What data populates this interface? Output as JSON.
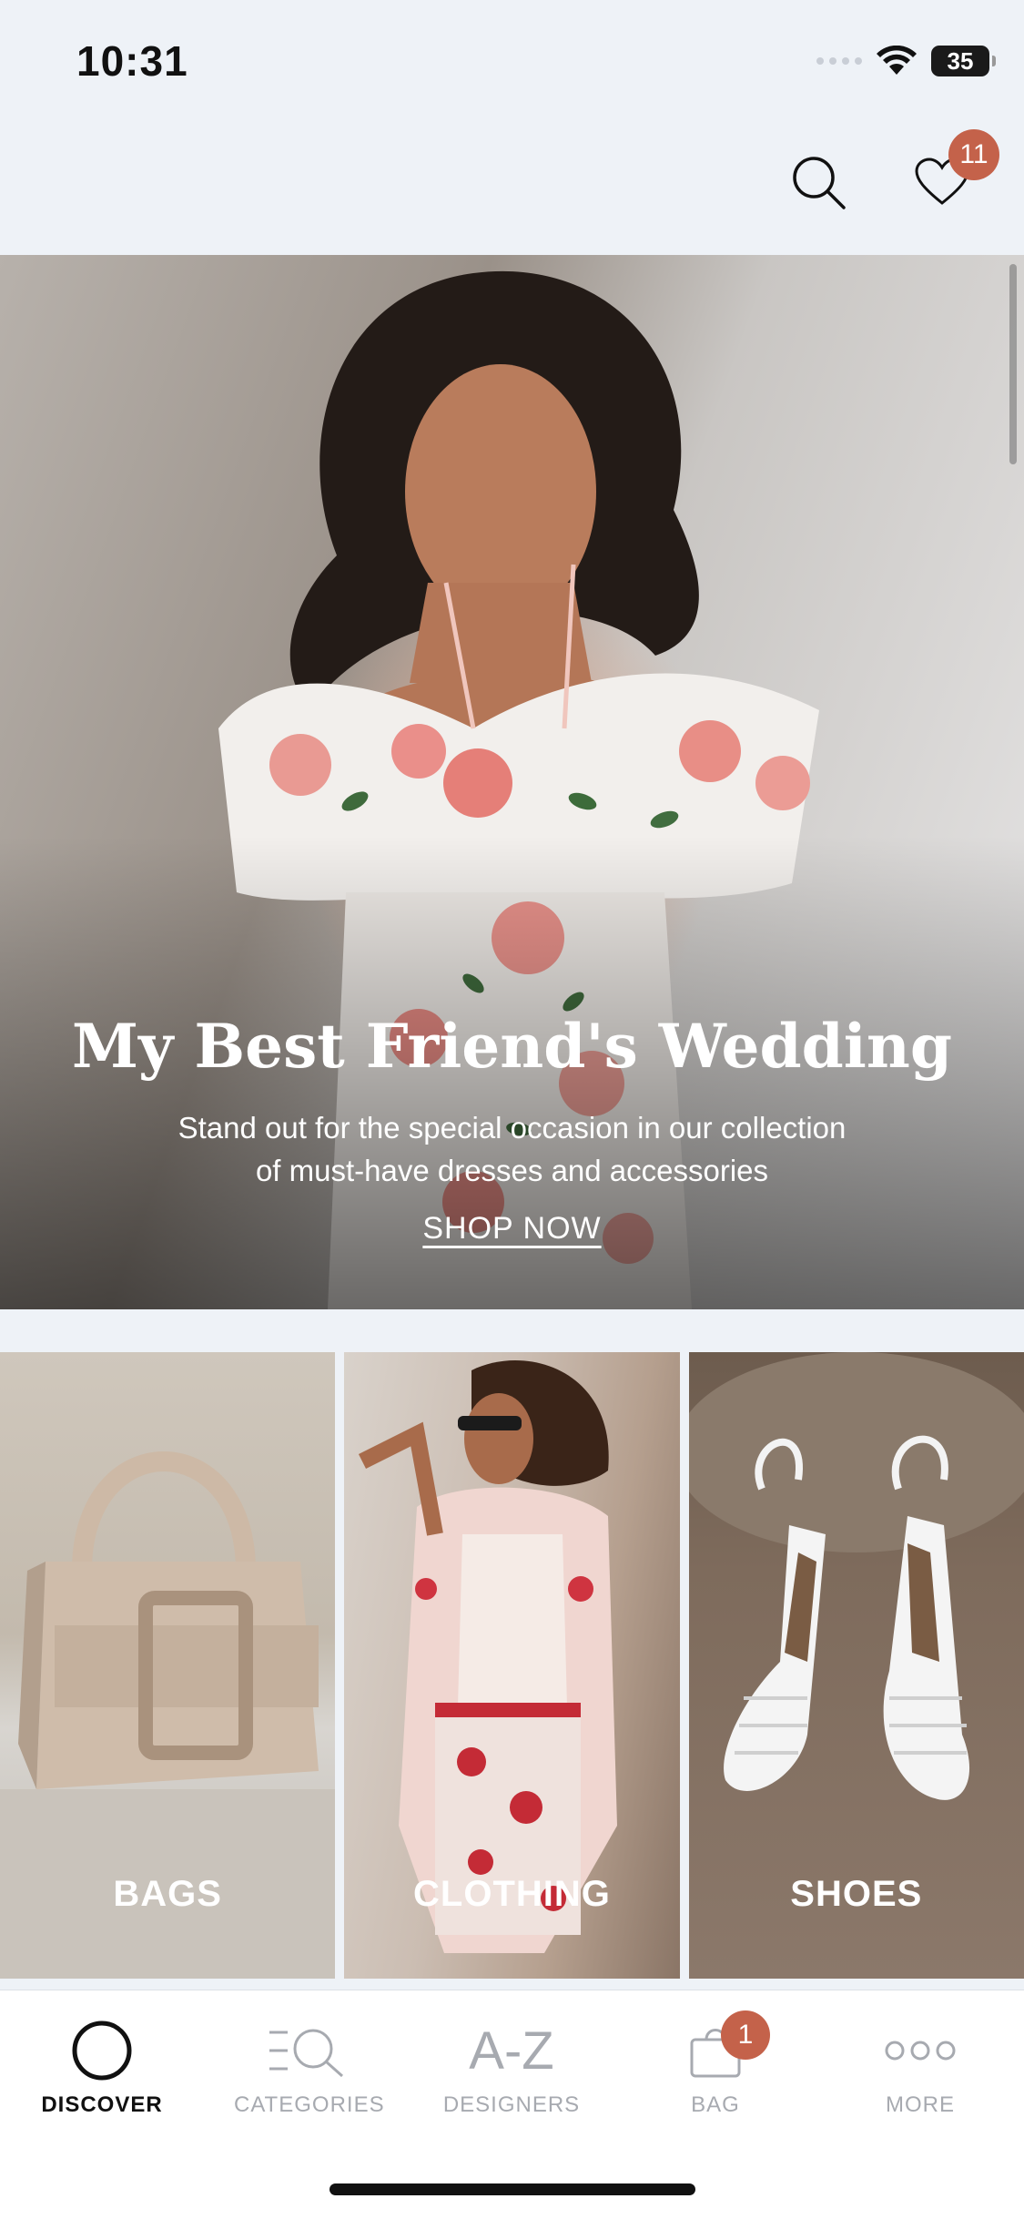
{
  "status_bar": {
    "time": "10:31",
    "battery": "35"
  },
  "header": {
    "wishlist_count": "11"
  },
  "hero": {
    "title": "My Best Friend's Wedding",
    "subtitle_line1": "Stand out for the special occasion in our collection",
    "subtitle_line2": "of must-have dresses and accessories",
    "cta": "SHOP NOW"
  },
  "categories": [
    {
      "label": "BAGS"
    },
    {
      "label": "CLOTHING"
    },
    {
      "label": "SHOES"
    }
  ],
  "tab_bar": {
    "items": [
      {
        "label": "DISCOVER",
        "icon": "circle-icon",
        "active": true
      },
      {
        "label": "CATEGORIES",
        "icon": "categories-icon",
        "active": false
      },
      {
        "label": "DESIGNERS",
        "icon": "az-icon",
        "glyph": "A-Z",
        "active": false
      },
      {
        "label": "BAG",
        "icon": "bag-icon",
        "active": false
      },
      {
        "label": "MORE",
        "icon": "more-icon",
        "active": false
      }
    ],
    "bag_count": "1"
  },
  "colors": {
    "accent": "#c4624a",
    "background": "#eef2f7",
    "active_tab": "#111111",
    "inactive_tab": "#a7aab0"
  }
}
